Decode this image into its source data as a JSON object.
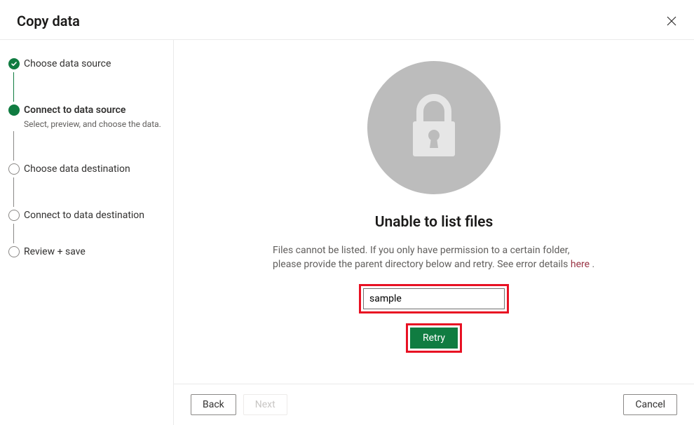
{
  "header": {
    "title": "Copy data"
  },
  "sidebar": {
    "steps": [
      {
        "label": "Choose data source",
        "desc": ""
      },
      {
        "label": "Connect to data source",
        "desc": "Select, preview, and choose the data."
      },
      {
        "label": "Choose data destination",
        "desc": ""
      },
      {
        "label": "Connect to data destination",
        "desc": ""
      },
      {
        "label": "Review + save",
        "desc": ""
      }
    ]
  },
  "main": {
    "error_title": "Unable to list files",
    "error_body_1": "Files cannot be listed. If you only have permission to a certain folder, please provide the parent directory below and retry. See error details ",
    "error_body_link": "here",
    "error_body_2": " .",
    "path_value": "sample",
    "retry_label": "Retry"
  },
  "footer": {
    "back_label": "Back",
    "next_label": "Next",
    "cancel_label": "Cancel"
  }
}
